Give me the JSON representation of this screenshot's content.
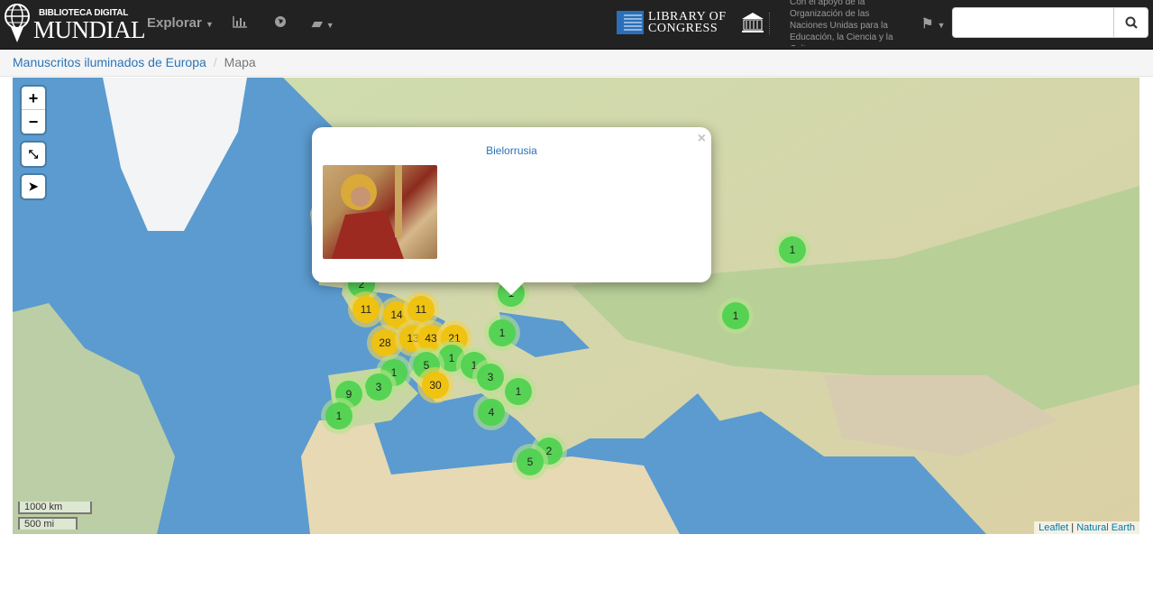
{
  "header": {
    "logo_small": "BIBLIOTECA DIGITAL",
    "logo_big": "MUNDIAL",
    "explore_label": "Explorar",
    "loc_line1": "LIBRARY OF",
    "loc_line2": "CONGRESS",
    "unesco_text": "Con el apoyo de la Organización de las Naciones Unidas para la Educación, la Ciencia y la Cultura",
    "search_placeholder": ""
  },
  "breadcrumb": {
    "parent": "Manuscritos iluminados de Europa",
    "current": "Mapa"
  },
  "map": {
    "zoom_in": "+",
    "zoom_out": "−",
    "popup": {
      "title": "Bielorrusia",
      "close": "×"
    },
    "clusters": [
      {
        "count": "2",
        "color": "green"
      },
      {
        "count": "1",
        "color": "green"
      },
      {
        "count": "11",
        "color": "yellow"
      },
      {
        "count": "14",
        "color": "yellow"
      },
      {
        "count": "11",
        "color": "yellow"
      },
      {
        "count": "28",
        "color": "yellow"
      },
      {
        "count": "13",
        "color": "yellow"
      },
      {
        "count": "43",
        "color": "yellow"
      },
      {
        "count": "21",
        "color": "yellow"
      },
      {
        "count": "1",
        "color": "green"
      },
      {
        "count": "1",
        "color": "green"
      },
      {
        "count": "5",
        "color": "green"
      },
      {
        "count": "1",
        "color": "green"
      },
      {
        "count": "1",
        "color": "green"
      },
      {
        "count": "3",
        "color": "green"
      },
      {
        "count": "3",
        "color": "green"
      },
      {
        "count": "30",
        "color": "yellow"
      },
      {
        "count": "9",
        "color": "green"
      },
      {
        "count": "1",
        "color": "green"
      },
      {
        "count": "4",
        "color": "green"
      },
      {
        "count": "1",
        "color": "green"
      },
      {
        "count": "2",
        "color": "green"
      },
      {
        "count": "5",
        "color": "green"
      },
      {
        "count": "1",
        "color": "green"
      },
      {
        "count": "1",
        "color": "green"
      }
    ],
    "scale_km": "1000 km",
    "scale_mi": "500 mi",
    "attribution": {
      "leaflet": "Leaflet",
      "sep": "|",
      "source": "Natural Earth"
    }
  }
}
